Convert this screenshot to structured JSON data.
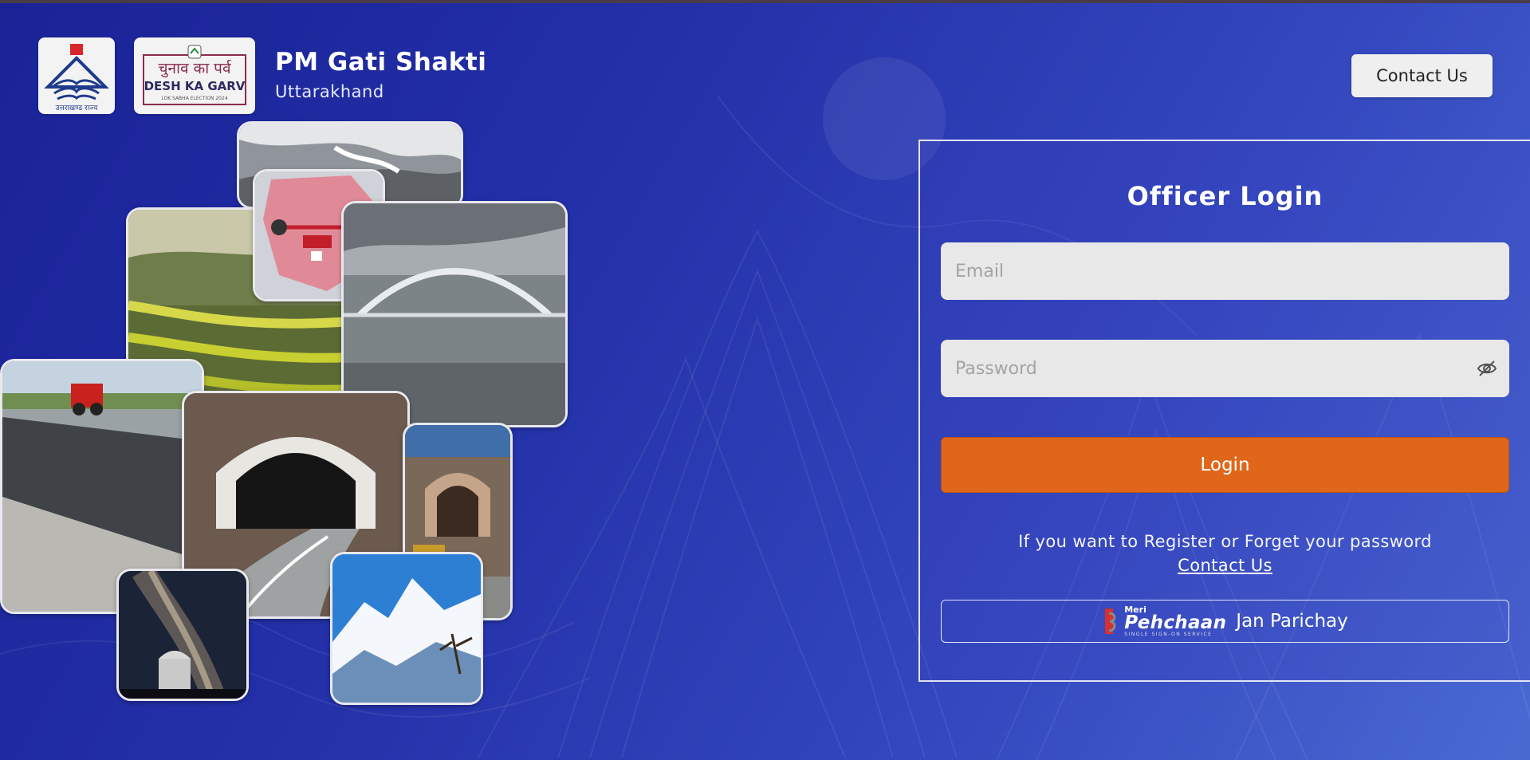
{
  "header": {
    "title": "PM Gati Shakti",
    "subtitle": "Uttarakhand",
    "logo1_text": "उत्तराखण्ड राज्य",
    "logo2_line1": "चुनाव का पर्व",
    "logo2_line2": "DESH KA GARV",
    "logo2_line3": "LOK SABHA ELECTION 2024",
    "contact_label": "Contact Us"
  },
  "login": {
    "title": "Officer Login",
    "email_placeholder": "Email",
    "password_placeholder": "Password",
    "login_label": "Login",
    "help_text": "If you want to Register or Forget your password",
    "help_link": "Contact Us",
    "jan_parichay": {
      "meri": "Meri",
      "brand": "Pehchaan",
      "tagline": "SINGLE SIGN-ON SERVICE",
      "label": "Jan Parichay"
    }
  },
  "colors": {
    "background_start": "#1a2296",
    "background_end": "#4a6ad2",
    "login_button": "#e06719"
  },
  "icons": [
    "eye-slash-icon",
    "uttarakhand-emblem-icon",
    "election-logo-icon",
    "meri-pehchaan-icon"
  ]
}
